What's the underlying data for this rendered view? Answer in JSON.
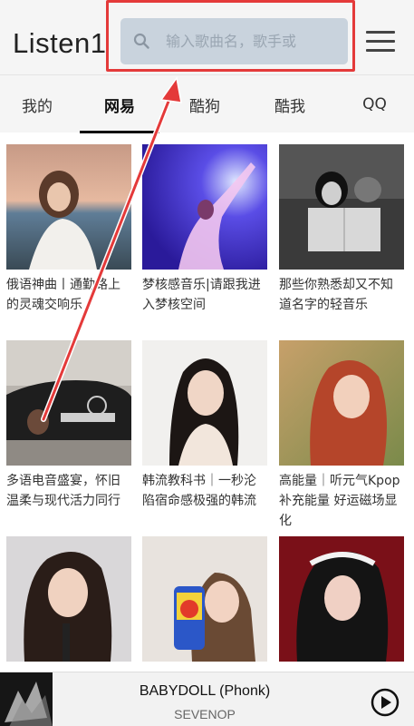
{
  "app": {
    "title": "Listen1"
  },
  "search": {
    "placeholder": "输入歌曲名，歌手或"
  },
  "menu": {
    "icon": "hamburger-menu-icon"
  },
  "tabs": [
    {
      "label": "我的",
      "active": false
    },
    {
      "label": "网易",
      "active": true
    },
    {
      "label": "酷狗",
      "active": false
    },
    {
      "label": "酷我",
      "active": false
    },
    {
      "label": "QQ",
      "active": false
    }
  ],
  "playlists": [
    {
      "title": "俄语神曲丨通勤路上的灵魂交响乐"
    },
    {
      "title": "梦核感音乐|请跟我进入梦核空间"
    },
    {
      "title": "那些你熟悉却又不知道名字的轻音乐"
    },
    {
      "title": "多语电音盛宴，怀旧温柔与现代活力同行"
    },
    {
      "title": "韩流教科书｜一秒沦陷宿命感极强的韩流"
    },
    {
      "title": "高能量｜听元气Kpop补充能量 好运磁场显化"
    },
    {
      "title": ""
    },
    {
      "title": ""
    },
    {
      "title": ""
    }
  ],
  "player": {
    "track_title": "BABYDOLL (Phonk)",
    "artist": "SEVENOP",
    "play_icon": "play-circle-icon"
  },
  "colors": {
    "header_bg": "#f5f5f5",
    "search_bg": "#c9d3dd",
    "annotation_red": "#e43a3a",
    "active_tab_underline": "#111111"
  }
}
